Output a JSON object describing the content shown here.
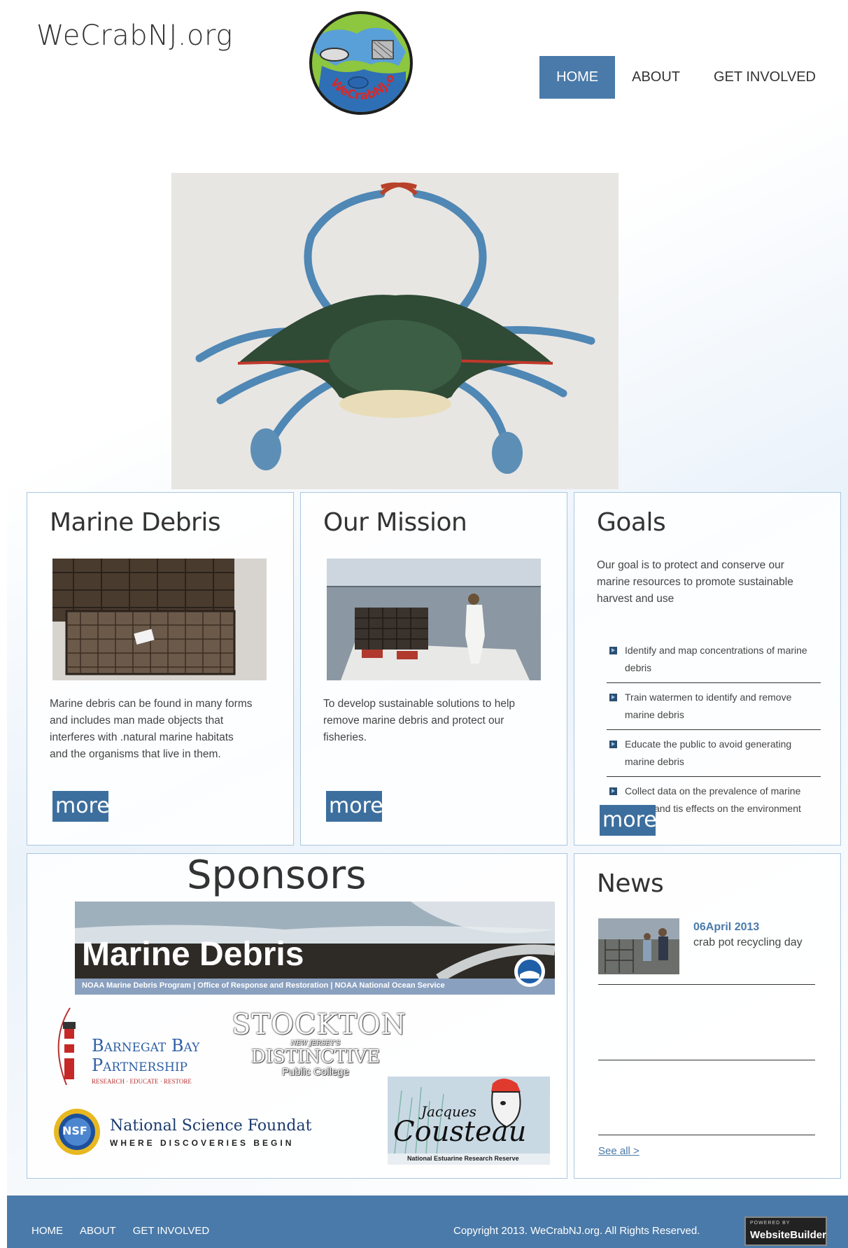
{
  "site": {
    "title": "WeCrabNJ.org",
    "logo_text": "WeCrabNJ.org"
  },
  "nav": {
    "items": [
      "HOME",
      "ABOUT",
      "GET INVOLVED"
    ],
    "active": "HOME"
  },
  "cards": {
    "marine_debris": {
      "title": "Marine Debris",
      "text": "Marine debris can be found in many forms and includes man made objects that interferes with .natural marine habitats and the organisms that live in them.",
      "more": "more"
    },
    "mission": {
      "title": "Our Mission",
      "text": "To develop sustainable solutions to help remove marine debris and protect our fisheries.",
      "more": "more"
    },
    "goals": {
      "title": "Goals",
      "text": "Our goal is to protect and conserve our marine resources to promote sustainable harvest and use",
      "items": [
        "Identify and map concentrations of marine debris",
        "Train watermen to identify and remove marine debris",
        "Educate the public to avoid generating marine debris",
        "Collect data on the prevalence of marine debris and tis effects on the environment"
      ],
      "more": "more"
    }
  },
  "sponsors": {
    "title": "Sponsors",
    "noaa_banner": {
      "title": "Marine Debris",
      "caption": "NOAA Marine Debris Program | Office of Response and Restoration | NOAA National Ocean Service"
    },
    "barnegat": {
      "line1": "Barnegat Bay",
      "line2": "Partnership",
      "tagline": "RESEARCH · EDUCATE · RESTORE"
    },
    "stockton": {
      "name": "STOCKTON",
      "sub1": "NEW JERSEY'S",
      "sub2": "DISTINCTIVE",
      "sub3": "Public College"
    },
    "nsf": {
      "name": "National Science Foundation",
      "tagline": "WHERE DISCOVERIES BEGIN",
      "badge": "NSF"
    },
    "cousteau": {
      "line1": "Jacques",
      "line2": "Cousteau",
      "caption": "National Estuarine Research Reserve"
    }
  },
  "news": {
    "title": "News",
    "items": [
      {
        "date": "06April 2013",
        "title": "crab pot recycling day"
      }
    ],
    "see_all": "See all >"
  },
  "footer": {
    "nav": [
      "HOME",
      "ABOUT",
      "GET INVOLVED"
    ],
    "copyright": "Copyright 2013. WeCrabNJ.org. All Rights Reserved.",
    "badge_small": "POWERED BY",
    "badge_big": "WebsiteBuilder"
  },
  "colors": {
    "accent": "#4a7aa9",
    "card_border": "#a9c7e0",
    "news_date": "#4a7aa9"
  }
}
